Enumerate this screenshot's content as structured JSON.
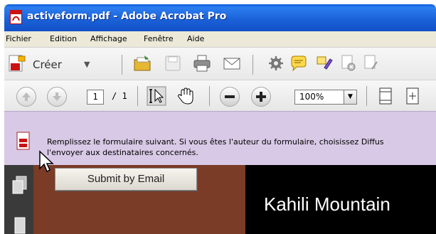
{
  "window": {
    "title": "activeform.pdf - Adobe Acrobat Pro",
    "icon": "acrobat-pdf-icon"
  },
  "menubar": {
    "items": [
      "Fichier",
      "Edition",
      "Affichage",
      "Fenêtre",
      "Aide"
    ]
  },
  "toolbar1": {
    "create_label": "Créer",
    "create_arrow": "▼",
    "icons": [
      "open-folder-icon",
      "save-icon",
      "print-icon",
      "email-icon",
      "settings-icon",
      "comment-icon",
      "highlight-icon",
      "secure-icon",
      "sign-icon"
    ]
  },
  "toolbar2": {
    "page_current": "1",
    "page_total": "/ 1",
    "zoom": "100%",
    "zoom_arrow": "▼",
    "icons": [
      "prev-page-icon",
      "next-page-icon",
      "select-tool-icon",
      "hand-tool-icon",
      "zoom-out-icon",
      "zoom-in-icon",
      "fit-page-icon",
      "fit-width-icon"
    ]
  },
  "message_bar": {
    "text": "Remplissez le formulaire suivant. Si vous êtes l'auteur du formulaire, choisissez Diffus\nl'envoyer aux destinataires concernés."
  },
  "navpanel": {
    "icons": [
      "pages-icon",
      "attachments-icon"
    ]
  },
  "document": {
    "submit_button": "Submit by Email",
    "heading": "Kahili Mountain"
  },
  "colors": {
    "titlebar": "#1b62d9",
    "message_bar": "#d8c9e6",
    "doc_brown": "#7a3b27",
    "doc_black": "#000000"
  }
}
